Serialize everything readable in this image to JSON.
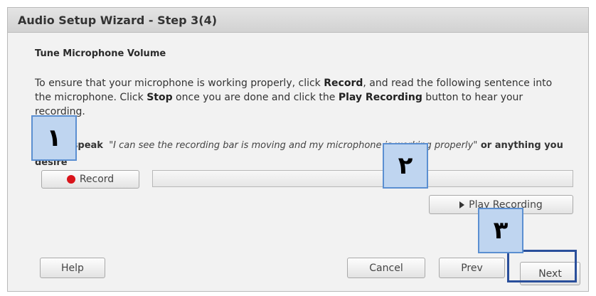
{
  "window": {
    "title": "Audio Setup Wizard - Step 3(4)"
  },
  "section": {
    "heading": "Tune Microphone Volume"
  },
  "instructions": {
    "part1": "To ensure that your microphone is working properly, click ",
    "record_word": "Record",
    "part2": ", and read the following sentence into the microphone. Click ",
    "stop_word": "Stop",
    "part3": " once you are done and click the ",
    "play_word": "Play Recording",
    "part4": " button to hear your recording."
  },
  "speak": {
    "label": "Please speak",
    "quote": "\"I can see the recording bar is moving and my microphone is working properly\"",
    "tail": " or anything you desire"
  },
  "buttons": {
    "record": "Record",
    "play_recording": "Play Recording",
    "help": "Help",
    "cancel": "Cancel",
    "prev": "Prev",
    "next": "Next"
  },
  "level_meter": {
    "level": 0
  },
  "badges": {
    "one": "١",
    "two": "٢",
    "three": "٣"
  },
  "colors": {
    "badge_fill": "#bfd5f0",
    "badge_border": "#5b8fd1",
    "highlight": "#2a4f9b",
    "record_dot": "#d9141b"
  },
  "icons": {
    "record": "record-dot-icon",
    "play": "play-triangle-icon"
  }
}
